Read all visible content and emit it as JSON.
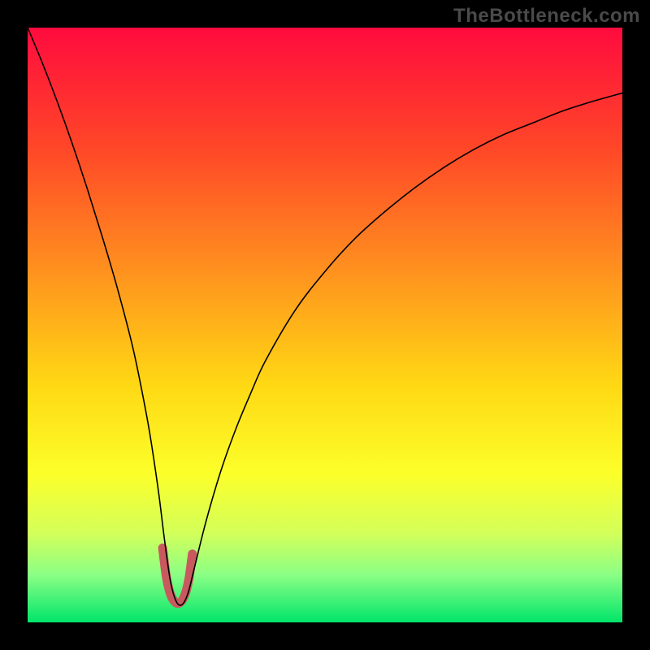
{
  "watermark": {
    "text": "TheBottleneck.com"
  },
  "chart_data": {
    "type": "line",
    "title": "",
    "xlabel": "",
    "ylabel": "",
    "xlim": [
      0,
      100
    ],
    "ylim": [
      0,
      100
    ],
    "grid": false,
    "legend": false,
    "background_gradient_stops": [
      {
        "offset": 0.0,
        "color": "#ff0b3e"
      },
      {
        "offset": 0.2,
        "color": "#ff4628"
      },
      {
        "offset": 0.4,
        "color": "#ff8e1f"
      },
      {
        "offset": 0.6,
        "color": "#ffd814"
      },
      {
        "offset": 0.75,
        "color": "#fcff2a"
      },
      {
        "offset": 0.85,
        "color": "#d3ff5a"
      },
      {
        "offset": 0.92,
        "color": "#8bff85"
      },
      {
        "offset": 1.0,
        "color": "#00e56a"
      }
    ],
    "series": [
      {
        "name": "bottleneck-curve",
        "stroke": "#000000",
        "stroke_width": 1.6,
        "x": [
          0,
          2.5,
          5,
          7.5,
          10,
          12.5,
          15,
          17.5,
          19,
          20.5,
          22,
          23,
          24,
          25,
          26,
          27,
          28,
          30,
          32.5,
          35,
          37.5,
          40,
          45,
          50,
          55,
          60,
          65,
          70,
          75,
          80,
          85,
          90,
          95,
          100
        ],
        "y": [
          100,
          94,
          87.5,
          80.5,
          73,
          65,
          56.5,
          47,
          40,
          32,
          22,
          14,
          7,
          3.5,
          3,
          5,
          9,
          17,
          25.5,
          32.5,
          38.5,
          44,
          52.5,
          59,
          64.5,
          69,
          73,
          76.5,
          79.5,
          82,
          84,
          86,
          87.6,
          89
        ]
      }
    ],
    "tip_highlight": {
      "stroke": "#c85a5f",
      "stroke_width": 11,
      "x": [
        22.7,
        23.3,
        24.0,
        24.8,
        25.6,
        26.4,
        27.1,
        27.7
      ],
      "y": [
        12.5,
        7.8,
        4.8,
        3.4,
        3.3,
        4.5,
        7.2,
        11.5
      ]
    }
  }
}
